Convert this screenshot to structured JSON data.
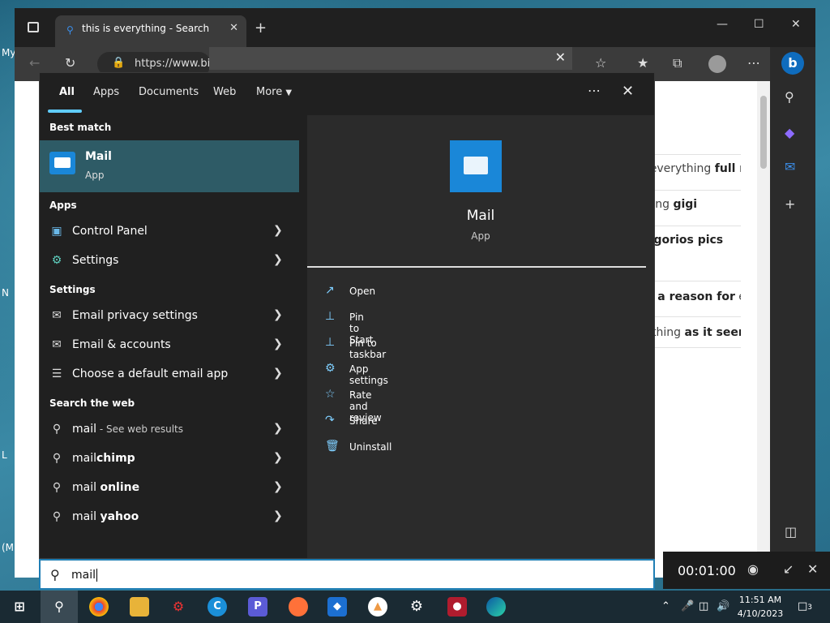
{
  "browser": {
    "tab_title": "this is everything - Search",
    "address": "https://www.bi",
    "suggestions": [
      {
        "pre": "s everything ",
        "bold": "full m"
      },
      {
        "pre": "thing ",
        "bold": "gigi"
      },
      {
        "pre": "",
        "bold": "orgorios pics"
      },
      {
        "pre": "",
        "bold": "re a reason for",
        "post": " ev"
      },
      {
        "pre": "rything ",
        "bold": "as it seem"
      }
    ]
  },
  "search_panel": {
    "tabs": [
      "All",
      "Apps",
      "Documents",
      "Web",
      "More"
    ],
    "best_match_header": "Best match",
    "best_match": {
      "title": "Mail",
      "subtitle": "App"
    },
    "apps_header": "Apps",
    "apps": [
      "Control Panel",
      "Settings"
    ],
    "settings_header": "Settings",
    "settings": [
      "Email privacy settings",
      "Email & accounts",
      "Choose a default email app"
    ],
    "web_header": "Search the web",
    "web": [
      {
        "prefix": "mail",
        "suffix": "",
        "sub": " - See web results"
      },
      {
        "prefix": "mail",
        "suffix": "chimp",
        "sub": ""
      },
      {
        "prefix": "mail ",
        "suffix": "online",
        "sub": ""
      },
      {
        "prefix": "mail ",
        "suffix": "yahoo",
        "sub": ""
      }
    ],
    "detail": {
      "title": "Mail",
      "subtitle": "App"
    },
    "actions": [
      "Open",
      "Pin to Start",
      "Pin to taskbar",
      "App settings",
      "Rate and review",
      "Share",
      "Uninstall"
    ]
  },
  "search_box": {
    "value": "mail"
  },
  "recorder": {
    "time": "00:01:00"
  },
  "taskbar": {
    "time": "11:51 AM",
    "date": "4/10/2023",
    "notifications": "3"
  },
  "desktop_labels": [
    "My",
    "N",
    "L",
    "(M"
  ],
  "colors": {
    "accent": "#60cdff",
    "best_match_bg": "#2e5b66",
    "mail_blue": "#1a87d8"
  }
}
